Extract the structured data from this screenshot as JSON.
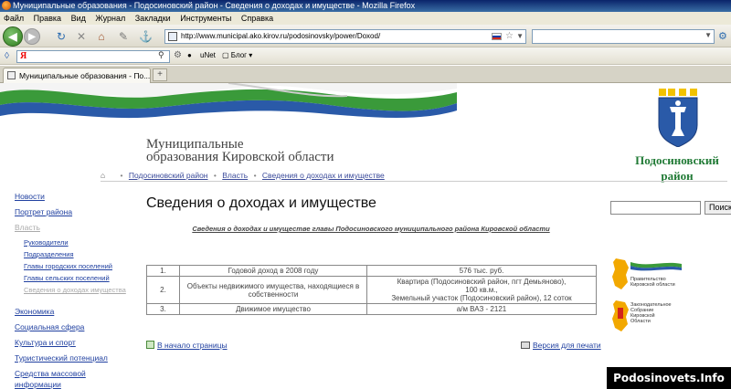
{
  "window": {
    "title": "Муниципальные образования - Подосиновский район - Сведения о доходах и имуществе - Mozilla Firefox"
  },
  "menu": [
    "Файл",
    "Правка",
    "Вид",
    "Журнал",
    "Закладки",
    "Инструменты",
    "Справка"
  ],
  "nav": {
    "url": "http://www.municipal.ako.kirov.ru/podosinovsky/power/Doxod/",
    "search_value": ""
  },
  "yandex_bar": {
    "logo": "Я",
    "unet_label": "uNet",
    "blog_label": "Блог"
  },
  "tab": {
    "label": "Муниципальные образования - По...",
    "new_tab": "+"
  },
  "site": {
    "title_line1": "Муниципальные",
    "title_line2": "образования Кировской области",
    "region_line1": "Подосиновский",
    "region_line2": "район"
  },
  "breadcrumb": [
    "Подосиновский район",
    "Власть",
    "Сведения о доходах и имуществе"
  ],
  "sidebar": {
    "items": [
      {
        "label": "Новости"
      },
      {
        "label": "Портрет района"
      },
      {
        "label": "Власть"
      }
    ],
    "sub_items": [
      {
        "label": "Руководители"
      },
      {
        "label": "Подразделения"
      },
      {
        "label": "Главы городских поселений"
      },
      {
        "label": "Главы сельских поселений"
      },
      {
        "label": "Сведения о доходах имущества"
      }
    ],
    "items2": [
      {
        "label": "Экономика"
      },
      {
        "label": "Социальная сфера"
      },
      {
        "label": "Культура и спорт"
      },
      {
        "label": "Туристический потенциал"
      },
      {
        "label": "Средства массовой информации"
      }
    ]
  },
  "main": {
    "heading": "Сведения о доходах и имуществе",
    "subtitle": "Сведения о доходах и имуществе главы Подосиновского муниципального района Кировской области",
    "table": [
      {
        "num": "1.",
        "label": "Годовой доход в 2008 году",
        "value": "576 тыс. руб."
      },
      {
        "num": "2.",
        "label": "Объекты недвижимого имущества, находящиеся в собственности",
        "value_lines": [
          "Квартира (Подосиновский район, пгт Демьяново),",
          "100 кв.м.,",
          "Земельный участок (Подосиновский район), 12 соток"
        ]
      },
      {
        "num": "3.",
        "label": "Движимое имущество",
        "value": "а/м ВАЗ - 2121"
      }
    ],
    "to_top_label": "В начало страницы",
    "print_label": "Версия для печати"
  },
  "right": {
    "search_button": "Поиск",
    "banner1_lines": [
      "Правительство",
      "Кировской области"
    ],
    "banner2_lines": [
      "Законодательное",
      "Собрание",
      "Кировской",
      "Области"
    ]
  },
  "watermark": "Podosinovets.Info",
  "colors": {
    "link": "#2040a0",
    "region_green": "#207a35",
    "ribbon_green": "#3a9a3a",
    "ribbon_blue": "#2a5aa8"
  }
}
